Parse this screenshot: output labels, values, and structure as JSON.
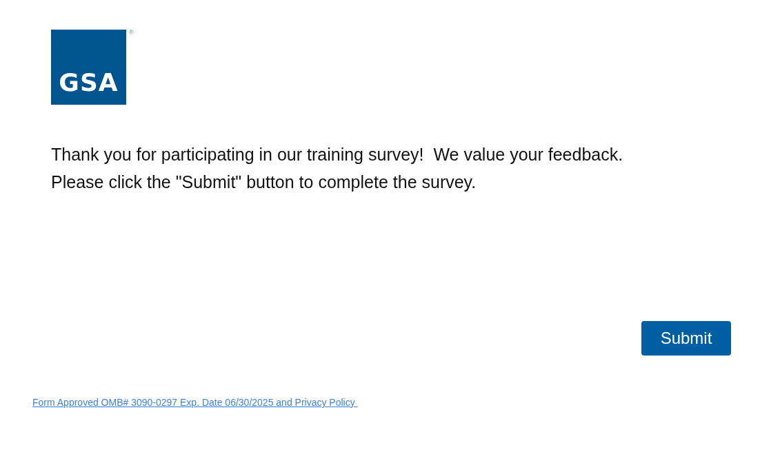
{
  "logo": {
    "text": "GSA",
    "mark": "®"
  },
  "message": [
    "Thank you for participating in our training survey!  We value your feedback.",
    "Please click the \"Submit\" button to complete the survey."
  ],
  "submit_button": "Submit",
  "footer_link": "Form Approved OMB# 3090-0297 Exp. Date 06/30/2025 and Privacy Policy "
}
